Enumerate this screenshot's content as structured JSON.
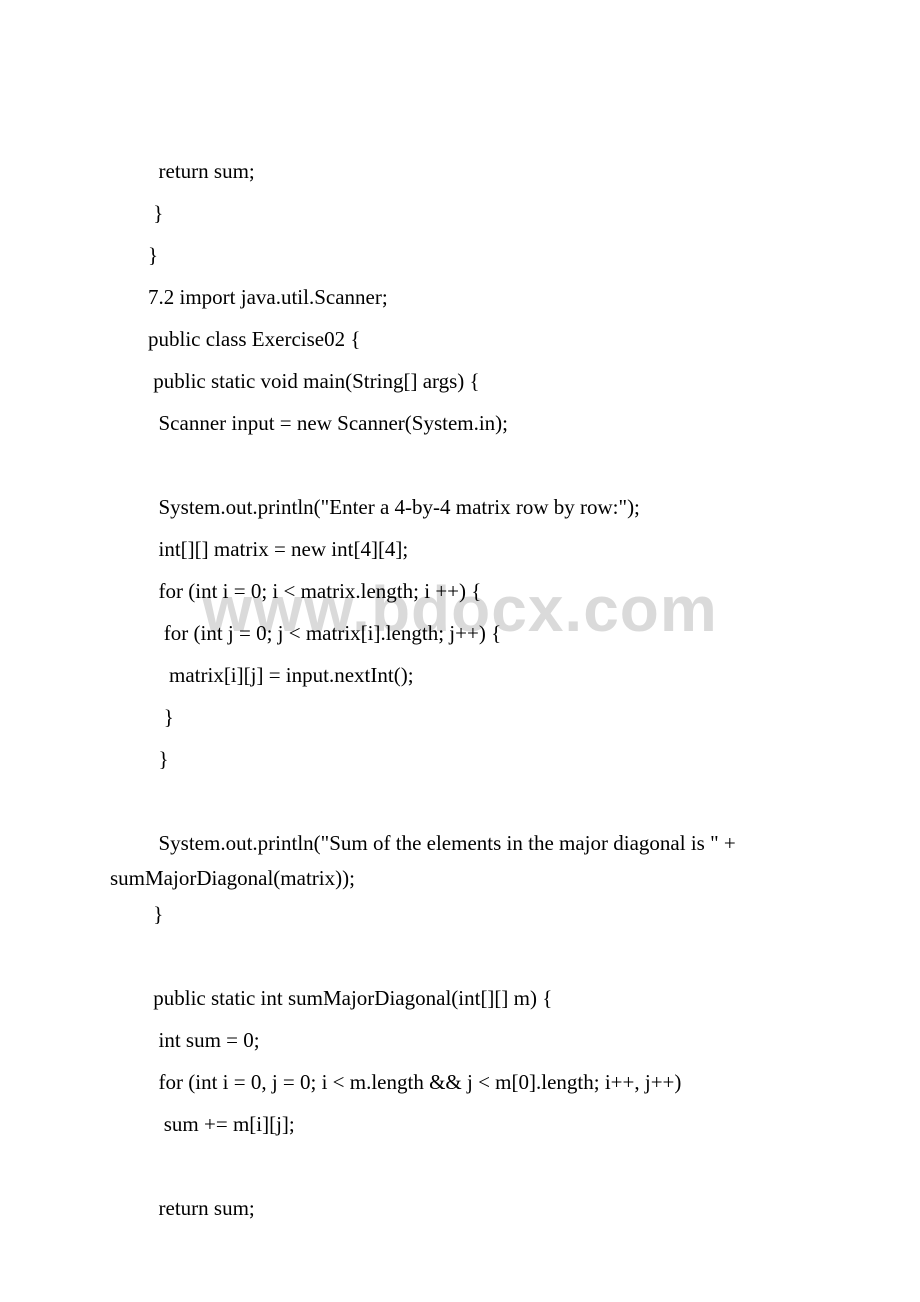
{
  "watermark": "www.bdocx.com",
  "lines": {
    "l1": "  return sum;",
    "l2": " }",
    "l3": "}",
    "l4": "7.2 import java.util.Scanner;",
    "l5": "public class Exercise02 {",
    "l6": " public static void main(String[] args) {",
    "l7": "  Scanner input = new Scanner(System.in);",
    "l8": "  System.out.println(\"Enter a 4-by-4 matrix row by row:\");",
    "l9": "  int[][] matrix = new int[4][4];",
    "l10": "  for (int i = 0; i < matrix.length; i ++) {",
    "l11": "   for (int j = 0; j < matrix[i].length; j++) {",
    "l12": "    matrix[i][j] = input.nextInt();",
    "l13": "   }",
    "l14": "  }",
    "l15a": "  System.out.println(\"Sum of the elements in the major diagonal is \" +",
    "l15b": "sumMajorDiagonal(matrix));",
    "l16": " }",
    "l17": " public static int sumMajorDiagonal(int[][] m) {",
    "l18": "  int sum = 0;",
    "l19": "  for (int i = 0, j = 0; i < m.length && j < m[0].length; i++, j++)",
    "l20": "   sum += m[i][j];",
    "l21": "  return sum;"
  }
}
